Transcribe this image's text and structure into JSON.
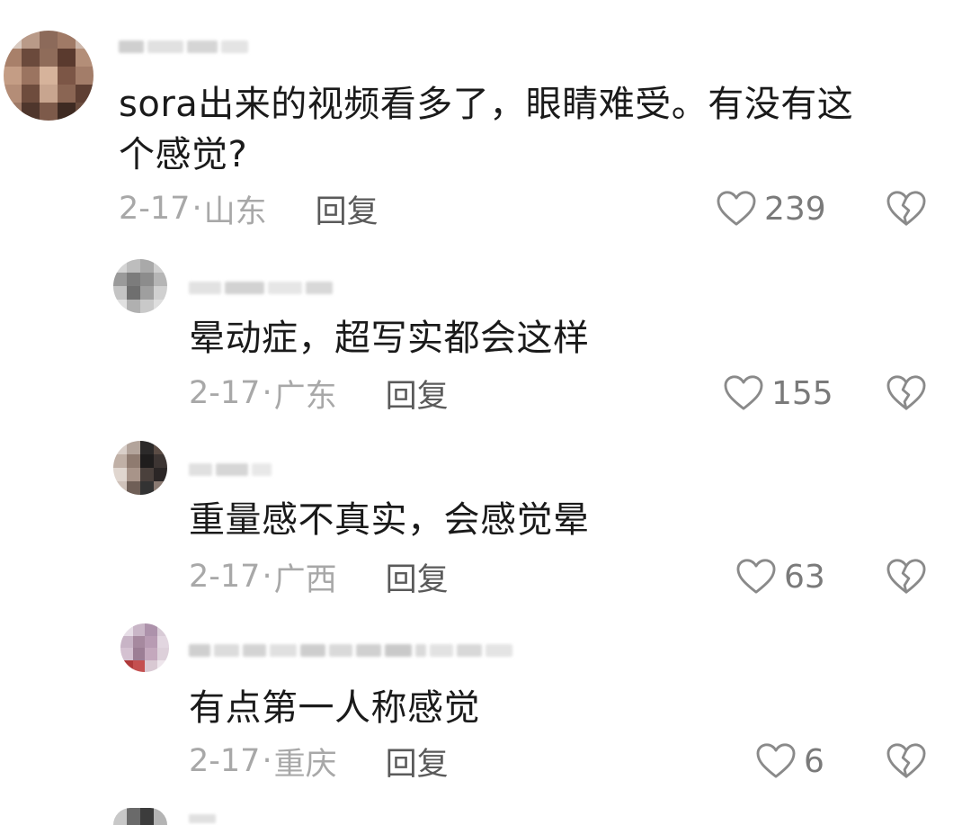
{
  "comments": [
    {
      "text_line1": "sora出来的视频看多了，眼睛难受。有没有这",
      "text_line2": "个感觉?",
      "date": "2-17",
      "location": "山东",
      "reply_label": "回复",
      "likes": "239"
    },
    {
      "text_line1": "晕动症，超写实都会这样",
      "date": "2-17",
      "location": "广东",
      "reply_label": "回复",
      "likes": "155"
    },
    {
      "text_line1": "重量感不真实，会感觉晕",
      "date": "2-17",
      "location": "广西",
      "reply_label": "回复",
      "likes": "63"
    },
    {
      "text_line1": "有点第一人称感觉",
      "date": "2-17",
      "location": "重庆",
      "reply_label": "回复",
      "likes": "6"
    }
  ],
  "separator": "·",
  "icons": {
    "like": "heart-outline-icon",
    "dislike": "broken-heart-icon"
  },
  "colors": {
    "text": "#1a1a1a",
    "meta": "#a8a8a8",
    "reply": "#5a5a5a",
    "icon": "#8a8a8a"
  }
}
